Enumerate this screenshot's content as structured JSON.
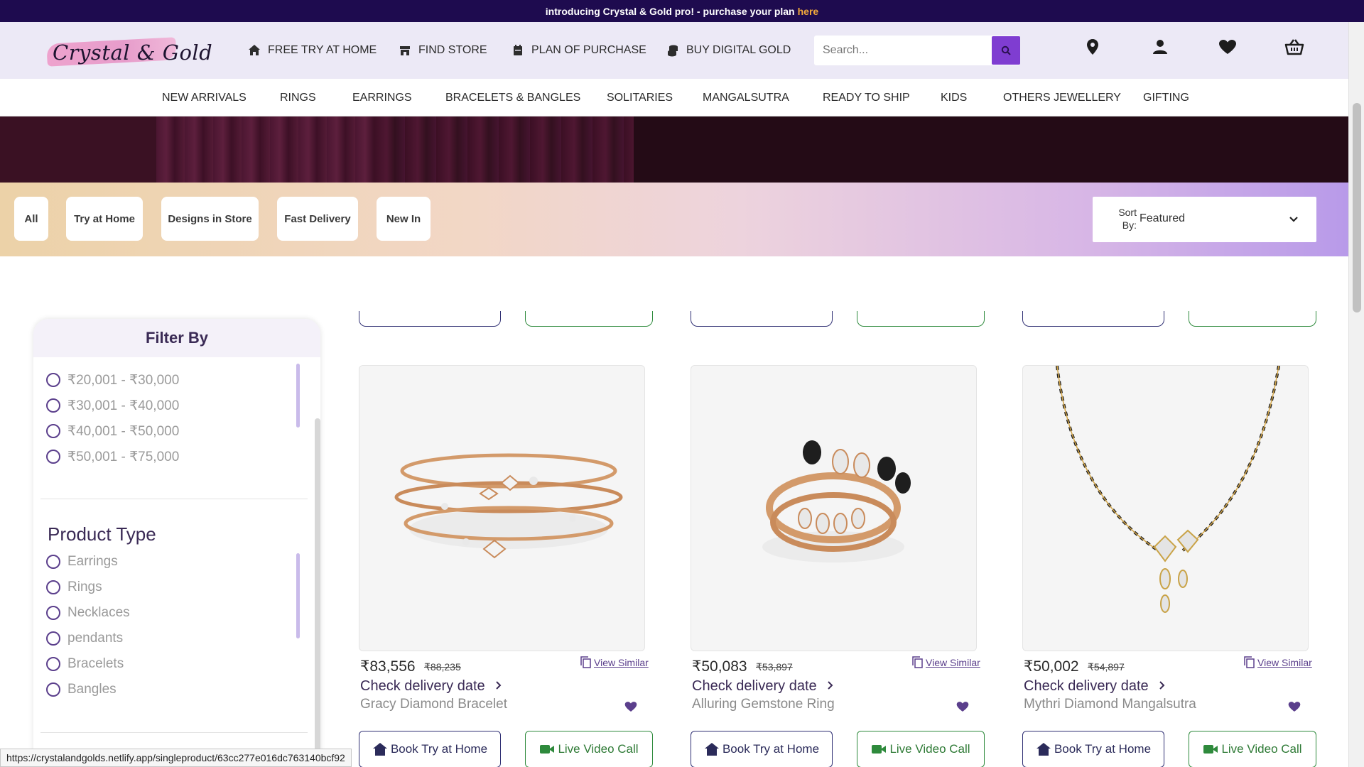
{
  "announcement": {
    "text": "introducing Crystal & Gold pro! - purchase your plan",
    "link": "here"
  },
  "brand": {
    "logo_text": "Crystal & Gold"
  },
  "header_nav": [
    {
      "label": "FREE TRY AT HOME",
      "icon": "home-icon"
    },
    {
      "label": "FIND STORE",
      "icon": "store-icon"
    },
    {
      "label": "PLAN OF PURCHASE",
      "icon": "calendar-icon"
    },
    {
      "label": "BUY DIGITAL GOLD",
      "icon": "coins-icon"
    }
  ],
  "search": {
    "placeholder": "Search..."
  },
  "header_icons": [
    "location-pin-icon",
    "user-icon",
    "heart-icon",
    "basket-icon"
  ],
  "category_nav": [
    "NEW ARRIVALS",
    "RINGS",
    "EARRINGS",
    "BRACELETS & BANGLES",
    "SOLITARIES",
    "MANGALSUTRA",
    "READY TO SHIP",
    "KIDS",
    "OTHERS JEWELLERY",
    "GIFTING"
  ],
  "filter_chips": [
    "All",
    "Try at Home",
    "Designs in Store",
    "Fast Delivery",
    "New In"
  ],
  "sort": {
    "label": "Sort By:",
    "value": "Featured"
  },
  "filter": {
    "title": "Filter By",
    "price_ranges": [
      "₹20,001 - ₹30,000",
      "₹30,001 - ₹40,000",
      "₹40,001 - ₹50,000",
      "₹50,001 - ₹75,000"
    ],
    "product_type_title": "Product Type",
    "product_types": [
      "Earrings",
      "Rings",
      "Necklaces",
      "pendants",
      "Bracelets",
      "Bangles"
    ]
  },
  "products": [
    {
      "name": "Gracy Diamond Bracelet",
      "price": "₹83,556",
      "mrp": "₹88,235",
      "view_similar": "View Similar",
      "delivery": "Check delivery date",
      "book_label": "Book Try at Home",
      "video_label": "Live Video Call"
    },
    {
      "name": "Alluring Gemstone Ring",
      "price": "₹50,083",
      "mrp": "₹53,897",
      "view_similar": "View Similar",
      "delivery": "Check delivery date",
      "book_label": "Book Try at Home",
      "video_label": "Live Video Call"
    },
    {
      "name": "Mythri Diamond Mangalsutra",
      "price": "₹50,002",
      "mrp": "₹54,897",
      "view_similar": "View Similar",
      "delivery": "Check delivery date",
      "book_label": "Book Try at Home",
      "video_label": "Live Video Call"
    }
  ],
  "status_url": "https://crystalandgolds.netlify.app/singleproduct/63cc277e016dc763140bcf92",
  "colors": {
    "announcement_bg": "#1e0b4f",
    "header_bg": "#ece9f6",
    "accent": "#7f3dd1",
    "here_link": "#f2a93b",
    "heart": "#5b3f8c"
  }
}
